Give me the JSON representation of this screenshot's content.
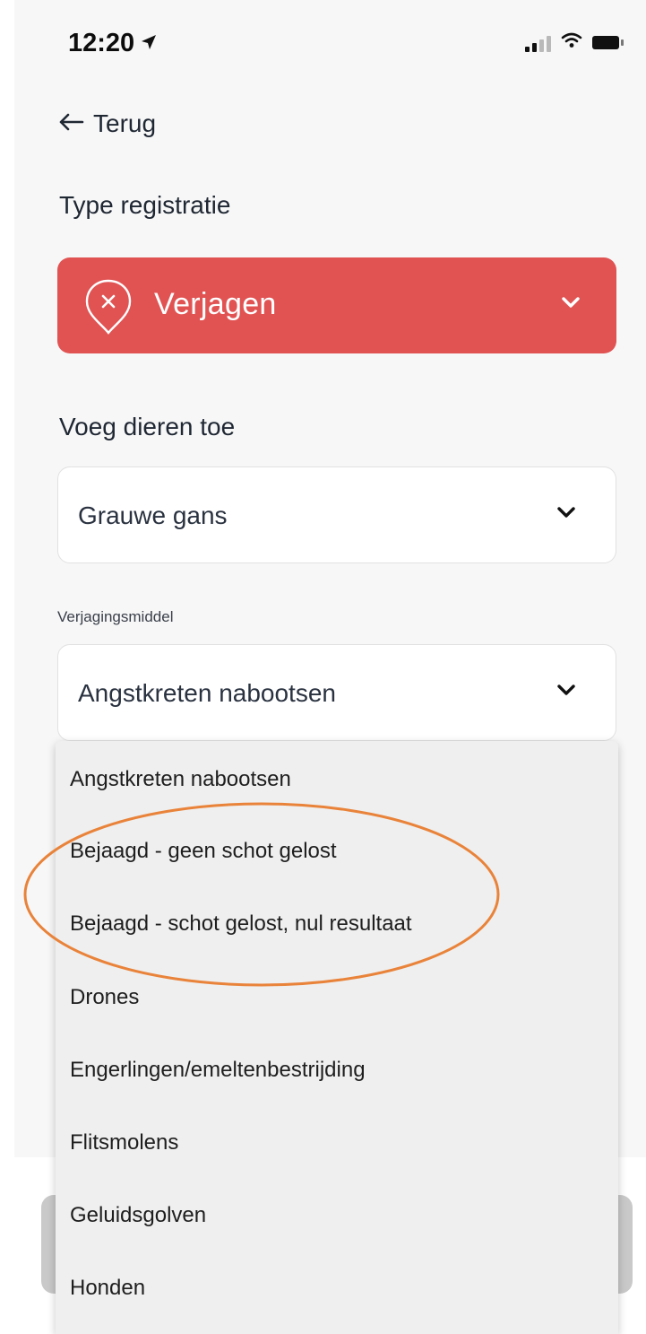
{
  "status_bar": {
    "time": "12:20"
  },
  "back": {
    "label": "Terug"
  },
  "type_section": {
    "label": "Type registratie",
    "value": "Verjagen",
    "accent": "#e15353"
  },
  "animals_section": {
    "label": "Voeg dieren toe",
    "value": "Grauwe gans"
  },
  "method_section": {
    "label": "Verjagingsmiddel",
    "value": "Angstkreten nabootsen",
    "options": [
      "Angstkreten nabootsen",
      "Bejaagd - geen schot gelost",
      "Bejaagd - schot gelost, nul resultaat",
      "Drones",
      "Engerlingen/emeltenbestrijding",
      "Flitsmolens",
      "Geluidsgolven",
      "Honden"
    ]
  },
  "annotation_color": "#e9833a"
}
